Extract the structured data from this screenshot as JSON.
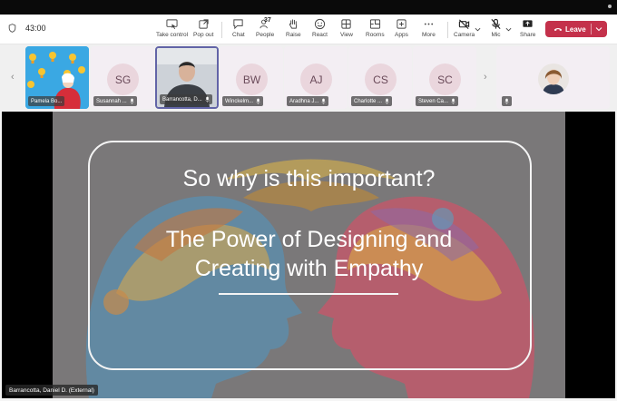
{
  "meeting": {
    "timer": "43:00"
  },
  "toolbar": {
    "take_control": "Take control",
    "pop_out": "Pop out",
    "chat": "Chat",
    "people": "People",
    "people_count": "37",
    "raise": "Raise",
    "react": "React",
    "view": "View",
    "rooms": "Rooms",
    "apps": "Apps",
    "more": "More",
    "camera": "Camera",
    "mic": "Mic",
    "share": "Share",
    "leave": "Leave"
  },
  "participants": [
    {
      "initials": "",
      "name": "Pamela Bo...",
      "kind": "video-lightbulbs"
    },
    {
      "initials": "SG",
      "name": "Susannah ...",
      "kind": "initials"
    },
    {
      "initials": "",
      "name": "Barrancotta, D...",
      "kind": "video-man",
      "active": true
    },
    {
      "initials": "BW",
      "name": "Winckelm...",
      "kind": "initials"
    },
    {
      "initials": "AJ",
      "name": "Aradhna J...",
      "kind": "initials"
    },
    {
      "initials": "CS",
      "name": "Charlotte ...",
      "kind": "initials"
    },
    {
      "initials": "SC",
      "name": "Steven Ca...",
      "kind": "initials"
    },
    {
      "initials": "",
      "name": "",
      "kind": "video-woman"
    }
  ],
  "slide": {
    "line1": "So why is this important?",
    "line2": "The Power of Designing and",
    "line3": "Creating with Empathy"
  },
  "speaker": {
    "label": "Barrancotta, Daniel D. (External)"
  },
  "colors": {
    "leave": "#c4314b",
    "active_tile": "#6264a7",
    "avatar_bg": "#ead6dd"
  }
}
